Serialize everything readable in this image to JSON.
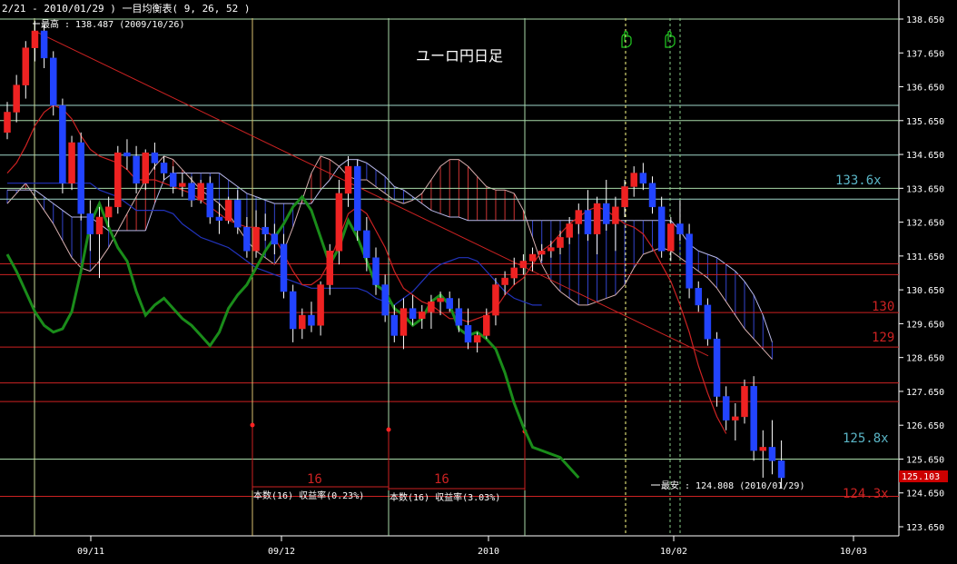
{
  "header": {
    "title": "2/21 - 2010/01/29 )   一目均衡表( 9, 26, 52 )",
    "high_note": "最高 : 138.487 (2009/10/26)",
    "low_note": "最安 : 124.808 (2010/01/29)"
  },
  "chart_data": {
    "type": "candlestick",
    "title": "ユーロ円日足",
    "indicator": "一目均衡表 (9, 26, 52)",
    "ylim": [
      123.2,
      139.0
    ],
    "x_ticks": [
      "09/11",
      "09/12",
      "2010",
      "10/02",
      "10/03"
    ],
    "y_ticks": [
      "138.650",
      "137.650",
      "136.650",
      "135.650",
      "134.650",
      "133.650",
      "132.650",
      "131.650",
      "130.650",
      "129.650",
      "128.650",
      "127.650",
      "126.650",
      "125.650",
      "124.650",
      "123.650"
    ],
    "last_price": "125.103",
    "level_labels": [
      "133.6x",
      "130",
      "129",
      "125.8x",
      "124.3x"
    ],
    "count_labels": [
      "16",
      "16"
    ],
    "stat_labels": [
      "本数(16) 収益率(0.23%)",
      "本数(16) 収益率(3.03%)"
    ],
    "candles": [
      [
        135.3,
        136.2,
        135.1,
        135.9
      ],
      [
        135.9,
        137.0,
        135.6,
        136.7
      ],
      [
        136.7,
        138.0,
        136.3,
        137.8
      ],
      [
        137.8,
        138.6,
        137.4,
        138.3
      ],
      [
        138.3,
        138.5,
        137.2,
        137.5
      ],
      [
        137.5,
        137.7,
        135.8,
        136.1
      ],
      [
        136.1,
        136.3,
        133.5,
        133.8
      ],
      [
        133.8,
        135.2,
        133.6,
        135.0
      ],
      [
        135.0,
        135.3,
        132.7,
        132.9
      ],
      [
        132.9,
        133.3,
        131.8,
        132.3
      ],
      [
        132.3,
        133.1,
        131.0,
        132.8
      ],
      [
        132.8,
        133.4,
        132.5,
        133.1
      ],
      [
        133.1,
        134.9,
        132.9,
        134.7
      ],
      [
        134.7,
        135.1,
        134.2,
        134.6
      ],
      [
        134.6,
        134.9,
        133.5,
        133.8
      ],
      [
        133.8,
        134.8,
        133.6,
        134.7
      ],
      [
        134.7,
        135.0,
        134.2,
        134.4
      ],
      [
        134.4,
        134.6,
        133.9,
        134.1
      ],
      [
        134.1,
        134.3,
        133.5,
        133.7
      ],
      [
        133.7,
        134.1,
        133.4,
        133.8
      ],
      [
        133.8,
        134.0,
        133.1,
        133.3
      ],
      [
        133.3,
        133.9,
        133.2,
        133.8
      ],
      [
        133.8,
        134.0,
        132.6,
        132.8
      ],
      [
        132.8,
        133.2,
        132.3,
        132.7
      ],
      [
        132.7,
        133.4,
        132.6,
        133.3
      ],
      [
        133.3,
        133.6,
        132.3,
        132.5
      ],
      [
        132.5,
        132.8,
        131.6,
        131.8
      ],
      [
        131.8,
        133.0,
        131.6,
        132.5
      ],
      [
        132.5,
        132.9,
        132.1,
        132.3
      ],
      [
        132.3,
        132.6,
        131.7,
        132.0
      ],
      [
        132.0,
        132.3,
        130.4,
        130.6
      ],
      [
        130.6,
        130.8,
        129.1,
        129.5
      ],
      [
        129.5,
        130.1,
        129.2,
        129.9
      ],
      [
        129.9,
        130.3,
        129.4,
        129.6
      ],
      [
        129.6,
        130.9,
        129.3,
        130.8
      ],
      [
        130.8,
        132.0,
        130.5,
        131.8
      ],
      [
        131.8,
        133.9,
        131.4,
        133.5
      ],
      [
        133.5,
        134.6,
        133.1,
        134.3
      ],
      [
        134.3,
        134.5,
        132.1,
        132.4
      ],
      [
        132.4,
        132.8,
        131.2,
        131.6
      ],
      [
        131.6,
        131.9,
        130.5,
        130.8
      ],
      [
        130.8,
        131.1,
        129.7,
        129.9
      ],
      [
        129.9,
        130.2,
        129.1,
        129.3
      ],
      [
        129.3,
        130.4,
        128.9,
        130.1
      ],
      [
        130.1,
        130.5,
        129.6,
        129.8
      ],
      [
        129.8,
        130.2,
        129.5,
        130.0
      ],
      [
        130.0,
        130.5,
        129.5,
        130.3
      ],
      [
        130.3,
        130.6,
        129.9,
        130.4
      ],
      [
        130.4,
        130.6,
        130.0,
        130.1
      ],
      [
        130.1,
        130.4,
        129.4,
        129.6
      ],
      [
        129.6,
        130.1,
        128.9,
        129.1
      ],
      [
        129.1,
        129.4,
        128.8,
        129.3
      ],
      [
        129.3,
        130.1,
        129.2,
        129.9
      ],
      [
        129.9,
        131.0,
        129.6,
        130.8
      ],
      [
        130.8,
        131.2,
        130.5,
        131.0
      ],
      [
        131.0,
        131.6,
        130.8,
        131.3
      ],
      [
        131.3,
        131.7,
        131.1,
        131.5
      ],
      [
        131.5,
        131.9,
        131.2,
        131.7
      ],
      [
        131.7,
        132.0,
        131.5,
        131.8
      ],
      [
        131.8,
        132.1,
        131.6,
        131.9
      ],
      [
        131.9,
        132.4,
        131.7,
        132.2
      ],
      [
        132.2,
        132.8,
        132.0,
        132.6
      ],
      [
        132.6,
        133.2,
        132.3,
        133.0
      ],
      [
        133.0,
        133.6,
        132.1,
        132.3
      ],
      [
        132.3,
        133.4,
        131.7,
        133.2
      ],
      [
        133.2,
        133.9,
        132.4,
        132.6
      ],
      [
        132.6,
        133.4,
        131.8,
        133.1
      ],
      [
        133.1,
        133.9,
        132.8,
        133.7
      ],
      [
        133.7,
        134.3,
        133.4,
        134.1
      ],
      [
        134.1,
        134.4,
        133.6,
        133.8
      ],
      [
        133.8,
        134.0,
        132.9,
        133.1
      ],
      [
        133.1,
        133.4,
        131.6,
        131.8
      ],
      [
        131.8,
        132.8,
        131.5,
        132.6
      ],
      [
        132.6,
        133.3,
        132.1,
        132.3
      ],
      [
        132.3,
        132.6,
        130.4,
        130.7
      ],
      [
        130.7,
        130.9,
        130.0,
        130.2
      ],
      [
        130.2,
        130.4,
        129.0,
        129.2
      ],
      [
        129.2,
        129.4,
        127.2,
        127.5
      ],
      [
        127.5,
        127.8,
        126.5,
        126.8
      ],
      [
        126.8,
        127.3,
        126.2,
        126.9
      ],
      [
        126.9,
        128.0,
        126.7,
        127.8
      ],
      [
        127.8,
        128.1,
        125.6,
        125.9
      ],
      [
        125.9,
        126.5,
        125.1,
        126.0
      ],
      [
        126.0,
        126.8,
        125.2,
        125.6
      ],
      [
        125.6,
        126.2,
        124.8,
        125.1
      ]
    ],
    "senkou_a": [
      133.2,
      133.5,
      133.8,
      133.4,
      133.0,
      132.6,
      132.1,
      131.6,
      131.3,
      131.2,
      131.5,
      131.9,
      132.4,
      132.9,
      133.4,
      133.9,
      134.3,
      134.6,
      134.5,
      134.2,
      133.9,
      133.6,
      133.4,
      133.2,
      132.9,
      132.5,
      132.1,
      131.8,
      131.6,
      131.4,
      131.8,
      132.5,
      133.3,
      134.1,
      134.6,
      134.5,
      134.3,
      134.0,
      133.9,
      133.9,
      133.7,
      133.5,
      133.3,
      133.2,
      133.3,
      133.5,
      133.9,
      134.3,
      134.5,
      134.5,
      134.3,
      134.0,
      133.7,
      133.6,
      133.6,
      133.5,
      133.0,
      132.2,
      131.4,
      130.9,
      130.6,
      130.4,
      130.2,
      130.2,
      130.3,
      130.4,
      130.5,
      130.8,
      131.3,
      131.7,
      131.8,
      131.9,
      131.8,
      131.6,
      131.4,
      131.2,
      131.0,
      130.7,
      130.3,
      129.9,
      129.5,
      129.2,
      128.9,
      128.6
    ],
    "senkou_b": [
      133.6,
      133.6,
      133.6,
      133.6,
      133.4,
      133.2,
      133.0,
      132.8,
      132.8,
      132.8,
      132.6,
      132.4,
      132.4,
      132.4,
      132.4,
      132.4,
      133.2,
      133.9,
      134.1,
      134.1,
      134.1,
      134.1,
      134.1,
      134.1,
      133.9,
      133.7,
      133.5,
      133.4,
      133.3,
      133.2,
      133.2,
      133.2,
      133.2,
      133.2,
      133.6,
      133.9,
      134.3,
      134.5,
      134.5,
      134.4,
      134.2,
      134.0,
      133.7,
      133.6,
      133.4,
      133.2,
      133.0,
      132.9,
      132.8,
      132.8,
      132.7,
      132.7,
      132.7,
      132.7,
      132.7,
      132.7,
      132.7,
      132.7,
      132.7,
      132.7,
      132.7,
      132.7,
      132.7,
      132.7,
      132.7,
      132.7,
      132.7,
      132.7,
      132.7,
      132.7,
      132.7,
      132.7,
      132.7,
      132.4,
      132.0,
      131.8,
      131.7,
      131.6,
      131.4,
      131.2,
      130.9,
      130.5,
      129.9,
      129.1
    ],
    "tenkan": [
      134.1,
      134.4,
      134.9,
      135.5,
      135.9,
      136.1,
      136.0,
      135.7,
      135.2,
      134.8,
      134.6,
      134.5,
      134.4,
      134.2,
      133.9,
      133.9,
      133.9,
      133.8,
      133.7,
      133.6,
      133.5,
      133.3,
      133.1,
      132.9,
      132.7,
      132.6,
      132.5,
      132.5,
      132.4,
      132.2,
      131.7,
      131.2,
      130.8,
      130.8,
      131.0,
      131.5,
      132.2,
      132.9,
      133.1,
      132.9,
      132.4,
      131.9,
      131.2,
      130.7,
      130.5,
      130.3,
      130.2,
      130.0,
      129.8,
      129.8,
      129.7,
      129.8,
      129.9,
      130.1,
      130.5,
      130.8,
      131.0,
      131.4,
      131.8,
      132.0,
      132.3,
      132.6,
      132.8,
      133.0,
      133.1,
      133.0,
      132.8,
      132.6,
      132.5,
      132.3,
      131.9,
      131.4,
      130.9,
      130.2,
      129.4,
      128.4,
      127.6,
      126.9,
      126.4
    ],
    "kijun": [
      133.8,
      133.8,
      133.8,
      133.8,
      133.8,
      133.8,
      133.8,
      133.8,
      133.8,
      133.8,
      133.6,
      133.5,
      133.4,
      133.2,
      133.0,
      133.0,
      133.0,
      133.0,
      132.9,
      132.6,
      132.4,
      132.2,
      132.1,
      132.0,
      131.9,
      131.7,
      131.5,
      131.3,
      131.2,
      131.1,
      131.0,
      130.9,
      130.8,
      130.7,
      130.7,
      130.7,
      130.7,
      130.7,
      130.7,
      130.6,
      130.4,
      130.3,
      130.2,
      130.4,
      130.6,
      130.9,
      131.2,
      131.4,
      131.5,
      131.6,
      131.6,
      131.5,
      131.2,
      130.9,
      130.6,
      130.4,
      130.3,
      130.2,
      130.2
    ],
    "chikou": [
      131.7,
      131.2,
      130.6,
      130.0,
      129.6,
      129.4,
      129.5,
      130.0,
      131.2,
      132.6,
      133.2,
      132.5,
      131.9,
      131.5,
      130.6,
      129.9,
      130.2,
      130.4,
      130.1,
      129.8,
      129.6,
      129.3,
      129.0,
      129.4,
      130.1,
      130.5,
      130.8,
      131.3,
      131.8,
      132.2,
      132.6,
      133.1,
      133.4,
      133.0,
      132.2,
      131.4,
      131.9,
      132.7,
      132.2,
      131.5,
      130.8,
      130.6,
      130.1,
      129.9,
      129.6,
      129.8,
      130.3,
      130.5,
      130.2,
      129.5,
      129.3,
      129.4,
      129.2,
      128.9,
      128.2,
      127.3,
      126.6,
      126.0,
      125.9,
      125.8,
      125.7,
      125.4,
      125.1
    ],
    "trendline": [
      [
        0,
        138.3
      ],
      [
        80,
        128.7
      ]
    ]
  }
}
